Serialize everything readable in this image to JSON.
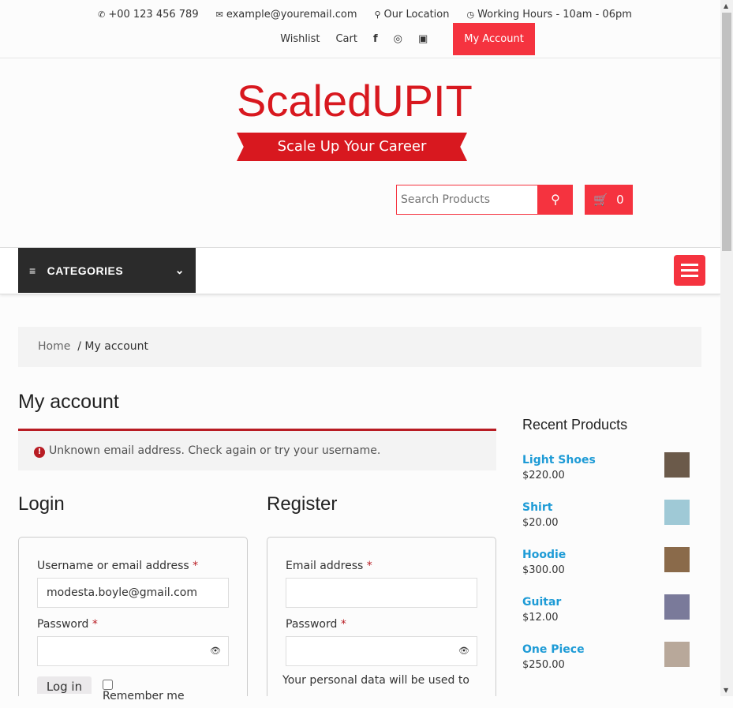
{
  "topbar": {
    "phone": "+00 123 456 789",
    "email": "example@youremail.com",
    "location": "Our Location",
    "hours": "Working Hours - 10am - 06pm",
    "wishlist": "Wishlist",
    "cart": "Cart",
    "my_account": "My Account"
  },
  "logo": {
    "name": "ScaledUPIT",
    "tagline": "Scale Up Your Career"
  },
  "search": {
    "placeholder": "Search Products"
  },
  "cart_count": "0",
  "nav": {
    "categories": "CATEGORIES"
  },
  "breadcrumb": {
    "home": "Home",
    "sep": "/",
    "current": "My account"
  },
  "page_title": "My account",
  "error": "Unknown email address. Check again or try your username.",
  "login": {
    "title": "Login",
    "username_label": "Username or email address",
    "username_value": "modesta.boyle@gmail.com",
    "password_label": "Password",
    "login_button": "Log in",
    "remember": "Remember me",
    "req": "*"
  },
  "register": {
    "title": "Register",
    "email_label": "Email address",
    "password_label": "Password",
    "privacy": "Your personal data will be used to"
  },
  "sidebar": {
    "title": "Recent Products",
    "products": [
      {
        "name": "Light Shoes",
        "price": "$220.00",
        "color": "#6b5a4a"
      },
      {
        "name": "Shirt",
        "price": "$20.00",
        "color": "#9fc9d6"
      },
      {
        "name": "Hoodie",
        "price": "$300.00",
        "color": "#8a6a4a"
      },
      {
        "name": "Guitar",
        "price": "$12.00",
        "color": "#7a7a9a"
      },
      {
        "name": "One Piece",
        "price": "$250.00",
        "color": "#b8a89a"
      }
    ]
  }
}
